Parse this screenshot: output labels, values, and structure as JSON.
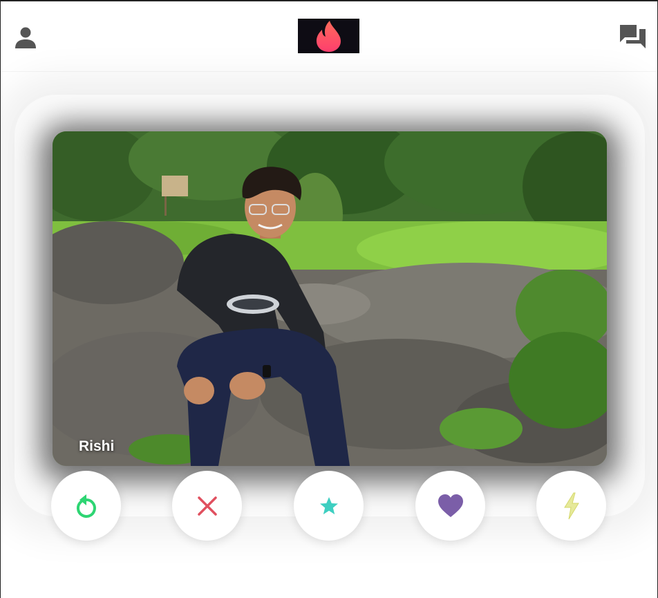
{
  "app": {
    "logo_icon": "flame-icon",
    "brand_color": "#fd5068",
    "brand_color_secondary": "#ff7a45"
  },
  "header": {
    "left_icon": "person-icon",
    "right_icon": "chat-bubbles-icon",
    "icon_color": "#555555"
  },
  "card": {
    "name": "Rishi",
    "photo": "man-sitting-on-rocks-outdoors-photo"
  },
  "actions": [
    {
      "name": "rewind",
      "icon": "rewind-icon",
      "color": "#2ed573"
    },
    {
      "name": "nope",
      "icon": "close-icon",
      "color": "#e0505f"
    },
    {
      "name": "super-like",
      "icon": "star-icon",
      "color": "#3ecfc1"
    },
    {
      "name": "like",
      "icon": "heart-icon",
      "color": "#7b5ea8"
    },
    {
      "name": "boost",
      "icon": "lightning-icon",
      "color": "#e6e99a"
    }
  ]
}
